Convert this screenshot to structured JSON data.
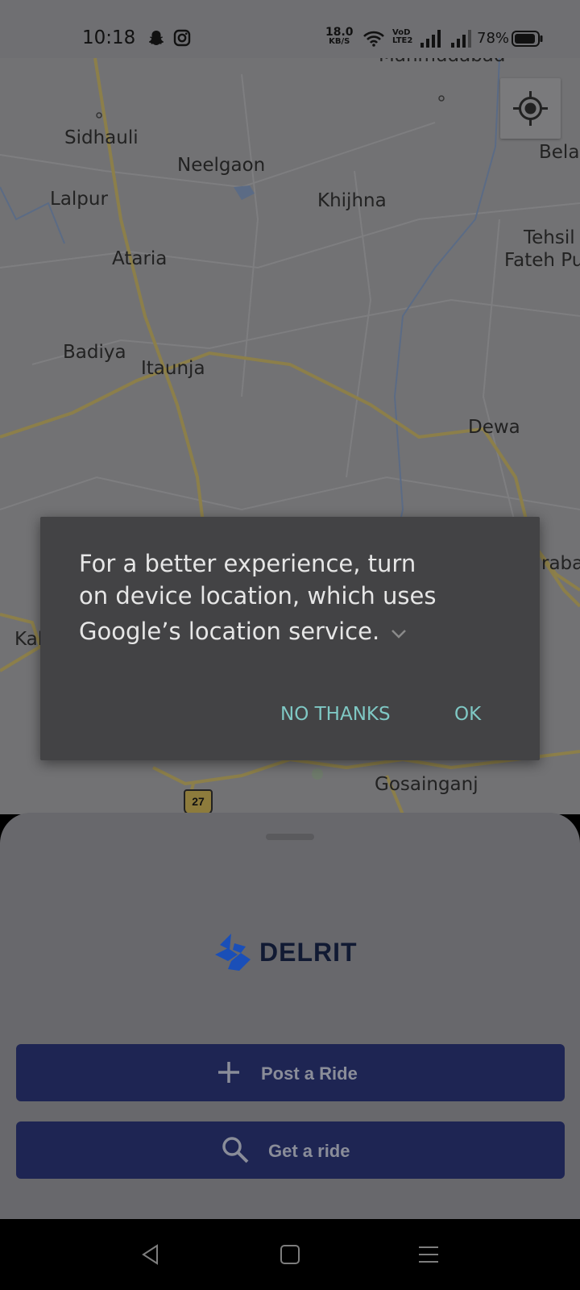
{
  "status_bar": {
    "time": "10:18",
    "net_speed_value": "18.0",
    "net_speed_unit": "KB/S",
    "volte_top": "VoD",
    "volte_bottom": "LTE2",
    "battery": "78%",
    "icons": [
      "snapchat-icon",
      "instagram-icon",
      "wifi-icon",
      "signal-icon",
      "signal-icon",
      "battery-icon"
    ]
  },
  "map": {
    "places": [
      {
        "name": "Mahmudabad"
      },
      {
        "name": "Sidhauli"
      },
      {
        "name": "Neelgaon"
      },
      {
        "name": "Belai"
      },
      {
        "name": "Lalpur"
      },
      {
        "name": "Khijhna"
      },
      {
        "name": "Tehsil"
      },
      {
        "name": "Fateh Pu"
      },
      {
        "name": "Ataria"
      },
      {
        "name": "Badiya"
      },
      {
        "name": "Itaunja"
      },
      {
        "name": "Dewa"
      },
      {
        "name": "Kal"
      },
      {
        "name": "raba"
      },
      {
        "name": "Gosainganj"
      }
    ],
    "highway_shield": "27",
    "locate_button_icon": "my-location-icon"
  },
  "dialog": {
    "line1": "For a better experience, turn",
    "line2": "on device location, which uses",
    "line3": "Google’s location service.",
    "expand_icon": "chevron-down-icon",
    "no_thanks": "NO THANKS",
    "ok": "OK"
  },
  "sheet": {
    "logo_text": "DELRIT",
    "post_ride_label": "Post a Ride",
    "get_ride_label": "Get a ride"
  },
  "colors": {
    "button_bg": "#1e2553",
    "dialog_bg": "#434345",
    "dialog_action": "#7fc8c4",
    "logo_blue": "#1a4fb8"
  },
  "nav": {
    "back_icon": "back-icon",
    "home_icon": "home-icon",
    "menu_icon": "menu-icon"
  }
}
